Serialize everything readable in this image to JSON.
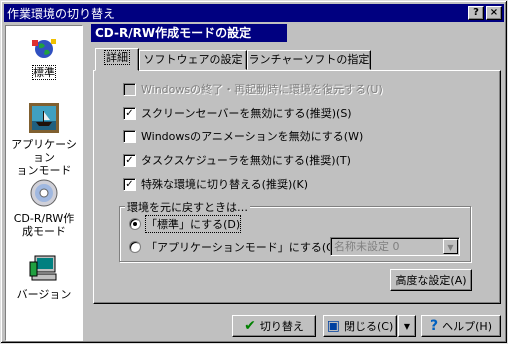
{
  "window": {
    "title": "作業環境の切り替え",
    "help_button": "?",
    "close_button": "×"
  },
  "sidebar": {
    "items": [
      {
        "label": "標準",
        "icon": "globe-icon"
      },
      {
        "label": "アプリケーション\nョンモード",
        "icon": "ship-painting-icon"
      },
      {
        "label": "CD-R/RW作\n成モード",
        "icon": "cd-disc-icon"
      },
      {
        "label": "バージョン",
        "icon": "computer-version-icon"
      }
    ]
  },
  "heading": "CD-R/RW作成モードの設定",
  "tabs": [
    "詳細",
    "ソフトウェアの設定",
    "ランチャーソフトの指定"
  ],
  "options": [
    {
      "label": "Windowsの終了・再起動時に環境を復元する(U)",
      "checked": false,
      "disabled": true
    },
    {
      "label": "スクリーンセーバーを無効にする(推奨)(S)",
      "checked": true,
      "disabled": false
    },
    {
      "label": "Windowsのアニメーションを無効にする(W)",
      "checked": false,
      "disabled": false
    },
    {
      "label": "タスクスケジューラを無効にする(推奨)(T)",
      "checked": true,
      "disabled": false
    },
    {
      "label": "特殊な環境に切り替える(推奨)(K)",
      "checked": true,
      "disabled": false
    }
  ],
  "restore_group": {
    "legend": "環境を元に戻すときは…",
    "radio_standard": "「標準」にする(D)",
    "radio_app": "「アプリケーションモード」にする(G)",
    "select_value": "名称未設定 0"
  },
  "buttons": {
    "advanced": "高度な設定(A)",
    "switch": "切り替え",
    "close": "閉じる(C)",
    "help": "ヘルプ(H)"
  },
  "colors": {
    "titlebar": "#000080",
    "face": "#c0c0c0"
  }
}
